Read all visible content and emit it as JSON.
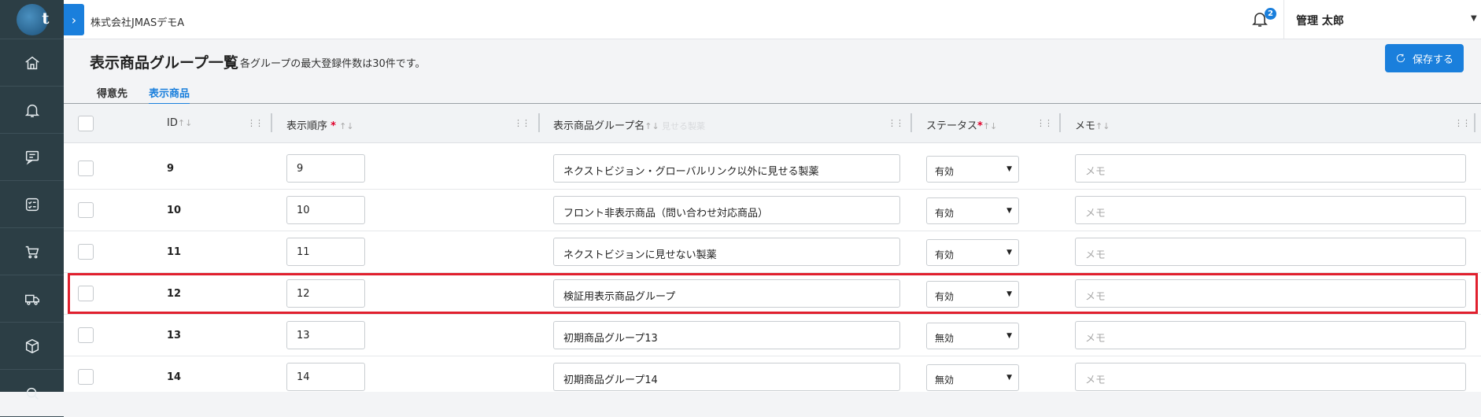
{
  "header": {
    "company": "株式会社JMASデモA",
    "notification_count": "2",
    "user_name": "管理 太郎"
  },
  "sidebar": {
    "logo_text": "t",
    "items": [
      {
        "icon": "home-icon"
      },
      {
        "icon": "bell-icon"
      },
      {
        "icon": "chat-icon"
      },
      {
        "icon": "checklist-icon"
      },
      {
        "icon": "cart-icon"
      },
      {
        "icon": "truck-icon"
      },
      {
        "icon": "box-icon"
      },
      {
        "icon": "search-icon"
      }
    ]
  },
  "page": {
    "title": "表示商品グループ一覧",
    "subtitle": "各グループの最大登録件数は30件です。",
    "save_label": "保存する"
  },
  "tabs": [
    {
      "label": "得意先",
      "active": false
    },
    {
      "label": "表示商品",
      "active": true
    }
  ],
  "grid": {
    "columns": {
      "id": "ID",
      "order": "表示順序",
      "name": "表示商品グループ名",
      "status": "ステータス",
      "memo": "メモ"
    },
    "ghost_text": "見せる製薬",
    "memo_placeholder": "メモ",
    "rows": [
      {
        "id": "9",
        "order": "9",
        "name": "ネクストビジョン・グローバルリンク以外に見せる製薬",
        "status": "有効"
      },
      {
        "id": "10",
        "order": "10",
        "name": "フロント非表示商品（問い合わせ対応商品）",
        "status": "有効"
      },
      {
        "id": "11",
        "order": "11",
        "name": "ネクストビジョンに見せない製薬",
        "status": "有効"
      },
      {
        "id": "12",
        "order": "12",
        "name": "検証用表示商品グループ",
        "status": "有効",
        "highlighted": true
      },
      {
        "id": "13",
        "order": "13",
        "name": "初期商品グループ13",
        "status": "無効"
      },
      {
        "id": "14",
        "order": "14",
        "name": "初期商品グループ14",
        "status": "無効"
      }
    ]
  },
  "colors": {
    "accent": "#1a7fdc",
    "sidebar": "#2c3e45",
    "highlight": "#e0202e",
    "required": "#e0002a"
  }
}
